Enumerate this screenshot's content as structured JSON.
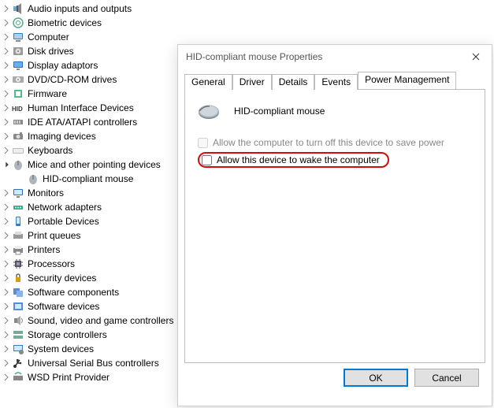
{
  "tree": {
    "items": [
      {
        "label": "Audio inputs and outputs",
        "icon": "audio",
        "expandable": true
      },
      {
        "label": "Biometric devices",
        "icon": "biometric",
        "expandable": true
      },
      {
        "label": "Computer",
        "icon": "computer",
        "expandable": true
      },
      {
        "label": "Disk drives",
        "icon": "disk",
        "expandable": true
      },
      {
        "label": "Display adaptors",
        "icon": "display",
        "expandable": true
      },
      {
        "label": "DVD/CD-ROM drives",
        "icon": "optical",
        "expandable": true
      },
      {
        "label": "Firmware",
        "icon": "firmware",
        "expandable": true
      },
      {
        "label": "Human Interface Devices",
        "icon": "hid",
        "expandable": true
      },
      {
        "label": "IDE ATA/ATAPI controllers",
        "icon": "ide",
        "expandable": true
      },
      {
        "label": "Imaging devices",
        "icon": "imaging",
        "expandable": true
      },
      {
        "label": "Keyboards",
        "icon": "keyboard",
        "expandable": true
      },
      {
        "label": "Mice and other pointing devices",
        "icon": "mouse",
        "expandable": true,
        "expanded": true,
        "children": [
          {
            "label": "HID-compliant mouse",
            "icon": "mouse"
          }
        ]
      },
      {
        "label": "Monitors",
        "icon": "monitor",
        "expandable": true
      },
      {
        "label": "Network adapters",
        "icon": "network",
        "expandable": true
      },
      {
        "label": "Portable Devices",
        "icon": "portable",
        "expandable": true
      },
      {
        "label": "Print queues",
        "icon": "printq",
        "expandable": true
      },
      {
        "label": "Printers",
        "icon": "printer",
        "expandable": true
      },
      {
        "label": "Processors",
        "icon": "cpu",
        "expandable": true
      },
      {
        "label": "Security devices",
        "icon": "security",
        "expandable": true
      },
      {
        "label": "Software components",
        "icon": "swcomp",
        "expandable": true
      },
      {
        "label": "Software devices",
        "icon": "swdev",
        "expandable": true
      },
      {
        "label": "Sound, video and game controllers",
        "icon": "sound",
        "expandable": true
      },
      {
        "label": "Storage controllers",
        "icon": "storage",
        "expandable": true
      },
      {
        "label": "System devices",
        "icon": "system",
        "expandable": true
      },
      {
        "label": "Universal Serial Bus controllers",
        "icon": "usb",
        "expandable": true
      },
      {
        "label": "WSD Print Provider",
        "icon": "wsd",
        "expandable": true
      }
    ]
  },
  "dialog": {
    "title": "HID-compliant mouse Properties",
    "tabs": [
      "General",
      "Driver",
      "Details",
      "Events",
      "Power Management"
    ],
    "active_tab_index": 4,
    "device_name": "HID-compliant mouse",
    "options": [
      {
        "label": "Allow the computer to turn off this device to save power",
        "checked": false,
        "enabled": false
      },
      {
        "label": "Allow this device to wake the computer",
        "checked": false,
        "enabled": true,
        "highlighted": true
      }
    ],
    "buttons": {
      "ok": "OK",
      "cancel": "Cancel"
    }
  }
}
